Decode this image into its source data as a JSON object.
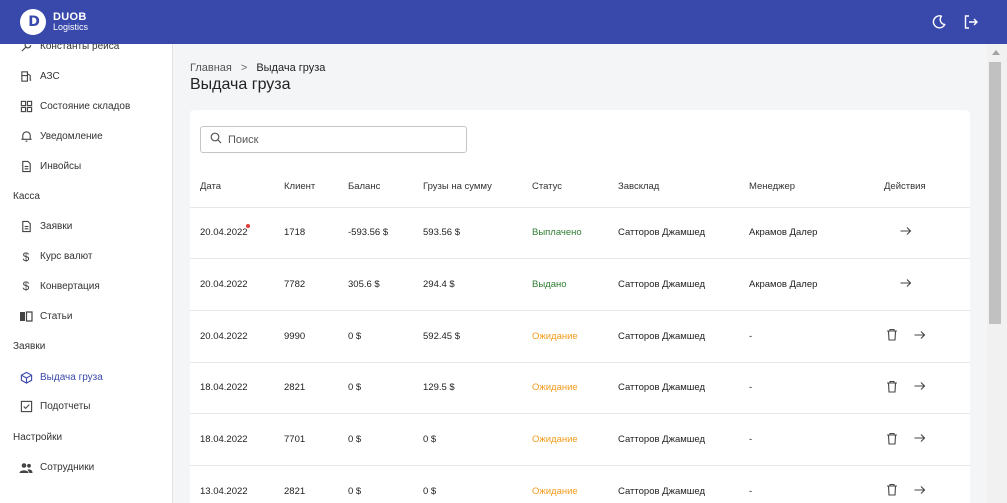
{
  "header": {
    "logo_mark": "D",
    "logo_line1": "DUOB",
    "logo_line2": "Logistics",
    "icons": [
      "moon-icon",
      "logout-icon"
    ],
    "color": "#3949ab"
  },
  "sidebar": {
    "items": [
      {
        "label": "Константы рейса",
        "icon": "wrench-icon"
      },
      {
        "label": "АЗС",
        "icon": "fuel-icon"
      },
      {
        "label": "Состояние складов",
        "icon": "grid-icon"
      },
      {
        "label": "Уведомление",
        "icon": "bell-icon"
      },
      {
        "label": "Инвойсы",
        "icon": "document-icon"
      }
    ],
    "section_kassa": "Касса",
    "kassa_items": [
      {
        "label": "Заявки",
        "icon": "document-icon"
      },
      {
        "label": "Курс валют",
        "icon": "dollar-icon"
      },
      {
        "label": "Конвертация",
        "icon": "dollar-icon"
      },
      {
        "label": "Статьи",
        "icon": "book-icon"
      }
    ],
    "section_zayavki": "Заявки",
    "zayavki_items": [
      {
        "label": "Выдача груза",
        "icon": "cube-icon",
        "active": true
      },
      {
        "label": "Подотчеты",
        "icon": "checkbox-icon"
      }
    ],
    "section_settings": "Настройки",
    "settings_items": [
      {
        "label": "Сотрудники",
        "icon": "people-icon"
      }
    ]
  },
  "breadcrumb": {
    "home": "Главная",
    "separator": ">",
    "current": "Выдача груза"
  },
  "page_title": "Выдача груза",
  "search": {
    "placeholder": "Поиск",
    "value": ""
  },
  "table": {
    "columns": [
      "Дата",
      "Клиент",
      "Баланс",
      "Грузы на сумму",
      "Статус",
      "Завсклад",
      "Менеджер",
      "Действия"
    ],
    "rows": [
      {
        "date": "20.04.2022",
        "client": "1718",
        "balance": "-593.56 $",
        "amount": "593.56 $",
        "status": "Выплачено",
        "status_type": "paid",
        "warehouse": "Сатторов Джамшед",
        "manager": "Акрамов Далер",
        "actions": [
          "arrow-right"
        ],
        "unread_dot": true
      },
      {
        "date": "20.04.2022",
        "client": "7782",
        "balance": "305.6 $",
        "amount": "294.4 $",
        "status": "Выдано",
        "status_type": "issued",
        "warehouse": "Сатторов Джамшед",
        "manager": "Акрамов Далер",
        "actions": [
          "arrow-right"
        ],
        "unread_dot": false
      },
      {
        "date": "20.04.2022",
        "client": "9990",
        "balance": "0 $",
        "amount": "592.45 $",
        "status": "Ожидание",
        "status_type": "wait",
        "warehouse": "Сатторов Джамшед",
        "manager": "-",
        "actions": [
          "trash",
          "arrow-right"
        ],
        "unread_dot": false
      },
      {
        "date": "18.04.2022",
        "client": "2821",
        "balance": "0 $",
        "amount": "129.5 $",
        "status": "Ожидание",
        "status_type": "wait",
        "warehouse": "Сатторов Джамшед",
        "manager": "-",
        "actions": [
          "trash",
          "arrow-right"
        ],
        "unread_dot": false
      },
      {
        "date": "18.04.2022",
        "client": "7701",
        "balance": "0 $",
        "amount": "0 $",
        "status": "Ожидание",
        "status_type": "wait",
        "warehouse": "Сатторов Джамшед",
        "manager": "-",
        "actions": [
          "trash",
          "arrow-right"
        ],
        "unread_dot": false
      },
      {
        "date": "13.04.2022",
        "client": "2821",
        "balance": "0 $",
        "amount": "0 $",
        "status": "Ожидание",
        "status_type": "wait",
        "warehouse": "Сатторов Джамшед",
        "manager": "-",
        "actions": [
          "trash",
          "arrow-right"
        ],
        "unread_dot": false
      }
    ]
  },
  "colors": {
    "accent": "#3949ab",
    "status_green": "#2e7d32",
    "status_orange": "#f29b1c",
    "dot_red": "#e53935"
  }
}
